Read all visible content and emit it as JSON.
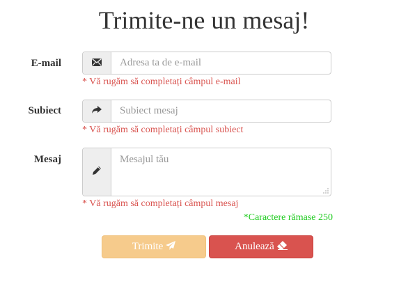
{
  "page": {
    "title": "Trimite-ne un mesaj!"
  },
  "form": {
    "email": {
      "label": "E-mail",
      "placeholder": "Adresa ta de e-mail",
      "icon": "envelope-icon",
      "error": "* Vă rugăm să completați câmpul e-mail"
    },
    "subject": {
      "label": "Subiect",
      "placeholder": "Subiect mesaj",
      "icon": "share-arrow-icon",
      "error": "* Vă rugăm să completați câmpul subiect"
    },
    "message": {
      "label": "Mesaj",
      "placeholder": "Mesajul tău",
      "icon": "pencil-icon",
      "error": "* Vă rugăm să completați câmpul mesaj",
      "counter": "*Caractere rămase 250"
    },
    "buttons": {
      "send_label": "Trimite",
      "send_icon": "paper-plane-icon",
      "cancel_label": "Anulează",
      "cancel_icon": "eraser-icon"
    }
  },
  "colors": {
    "error": "#d9534f",
    "counter": "#22cc22",
    "send_button": "#f6cb8c",
    "cancel_button": "#d9534f",
    "addon_bg": "#eeeeee"
  }
}
